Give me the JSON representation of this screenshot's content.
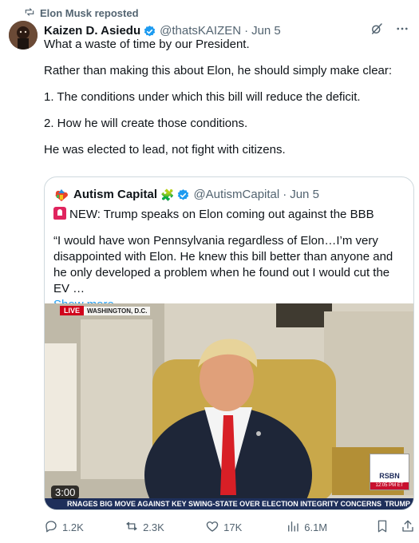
{
  "repost": {
    "label": "Elon Musk reposted"
  },
  "tweet": {
    "author_name": "Kaizen D. Asiedu",
    "handle": "@thatsKAIZEN",
    "separator": "·",
    "date": "Jun 5",
    "paragraphs": [
      "What a waste of time by our President.",
      "Rather than making this about Elon, he should simply make clear:",
      "1. The conditions under which this bill will reduce the deficit.",
      "2. How he will create those conditions.",
      "He was elected to lead, not fight with citizens."
    ]
  },
  "quote": {
    "author_name": "Autism Capital",
    "puzzle_emoji": "🧩",
    "handle": "@AutismCapital",
    "separator": "·",
    "date": "Jun 5",
    "headline": "NEW: Trump speaks on Elon coming out against the BBB",
    "body": "“I would have won Pennsylvania regardless of Elon…I’m very disappointed with Elon. He knew this bill better than anyone and he only developed a problem when he found out I would cut the EV …",
    "show_more": "Show more"
  },
  "video": {
    "live_label": "LIVE",
    "location": "WASHINGTON, D.C.",
    "duration": "3:00",
    "ticker": "RNAGES BIG MOVE AGAINST KEY SWING-STATE OVER ELECTION INTEGRITY CONCERNS",
    "ticker_end": "TRUMP",
    "network": "RSBN",
    "clock": "12:05 PM ET"
  },
  "actions": {
    "replies": "1.2K",
    "reposts": "2.3K",
    "likes": "17K",
    "views": "6.1M"
  },
  "colors": {
    "accent": "#1d9bf0",
    "verified": "#1d9bf0",
    "muted": "#536471",
    "border": "#cfd9de",
    "live_red": "#d0021b"
  },
  "icons": [
    "repost-icon",
    "verified-badge-icon",
    "grok-icon",
    "more-icon",
    "reply-icon",
    "like-icon",
    "views-icon",
    "bookmark-icon",
    "share-icon"
  ]
}
